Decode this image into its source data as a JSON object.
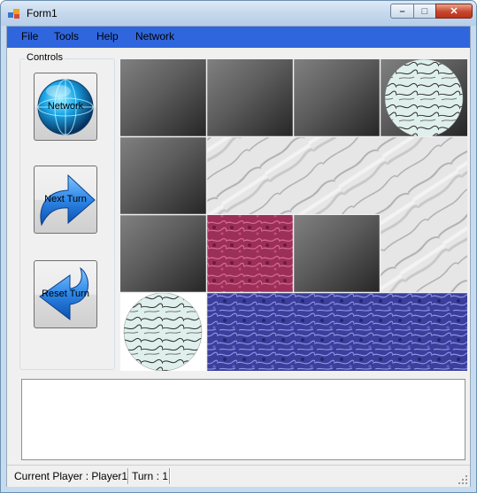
{
  "window": {
    "title": "Form1",
    "minimize_glyph": "–",
    "maximize_glyph": "□",
    "close_glyph": "✕"
  },
  "menu": {
    "items": [
      "File",
      "Tools",
      "Help",
      "Network"
    ]
  },
  "controls": {
    "group_label": "Controls",
    "buttons": [
      {
        "label": "Network",
        "icon": "globe-icon"
      },
      {
        "label": "Next Turn",
        "icon": "arrow-right-icon"
      },
      {
        "label": "Reset Turn",
        "icon": "arrow-left-icon"
      }
    ]
  },
  "board": {
    "columns": 4,
    "rows": 4,
    "cells": [
      [
        "dark",
        "dark",
        "dark",
        "stone-white"
      ],
      [
        "dark",
        "marble-white",
        "marble-white",
        "marble-white"
      ],
      [
        "dark",
        "marble-pink",
        "dark",
        "marble-white"
      ],
      [
        "stone-white",
        "marble-blue",
        "marble-blue",
        "marble-blue"
      ]
    ]
  },
  "output": {
    "text": ""
  },
  "status": {
    "player": "Current Player : Player1",
    "turn": "Turn : 1"
  },
  "colors": {
    "menubar": "#2f66dd",
    "pink_tile": "#a0355c",
    "blue_tile": "#3a3f98",
    "dark_tile": "#4a4a4a"
  }
}
